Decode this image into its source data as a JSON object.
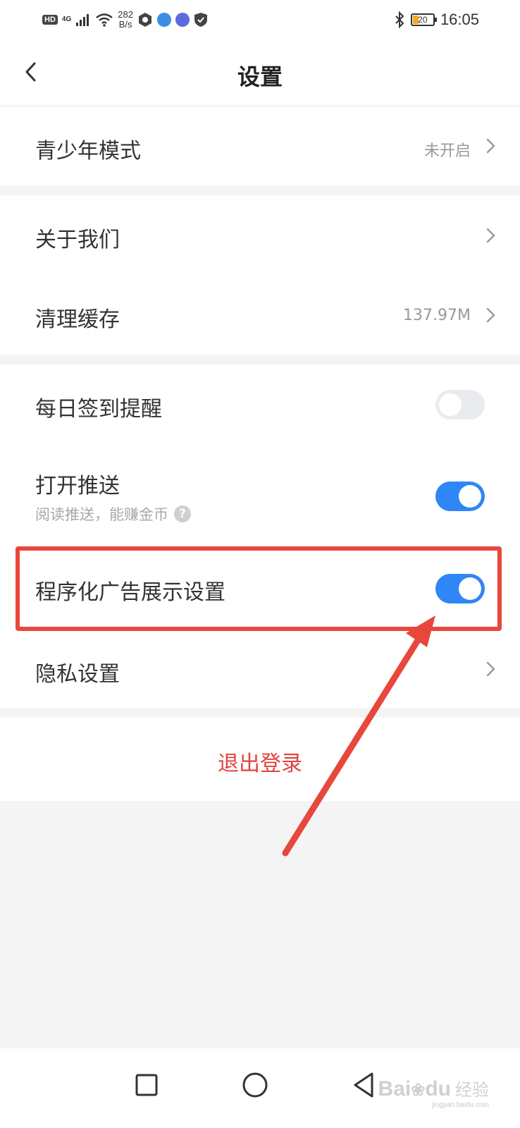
{
  "status_bar": {
    "hd": "HD",
    "network": "4G",
    "speed_value": "282",
    "speed_unit": "B/s",
    "battery_level": "20",
    "time": "16:05"
  },
  "header": {
    "title": "设置",
    "back_icon": "chevron-left-icon"
  },
  "sections": {
    "teen": {
      "label": "青少年模式",
      "value": "未开启"
    },
    "about": {
      "label": "关于我们"
    },
    "cache": {
      "label": "清理缓存",
      "value": "137.97M"
    },
    "checkin": {
      "label": "每日签到提醒",
      "toggle": "off"
    },
    "push": {
      "label": "打开推送",
      "subtitle": "阅读推送，能赚金币",
      "help_glyph": "?",
      "toggle": "on"
    },
    "ads": {
      "label": "程序化广告展示设置",
      "toggle": "on"
    },
    "privacy": {
      "label": "隐私设置"
    }
  },
  "logout": {
    "label": "退出登录"
  },
  "watermark": {
    "brand": "Bai",
    "brand2": "du",
    "cn": "经验",
    "url": "jingyan.baidu.com"
  },
  "colors": {
    "accent_blue": "#2f86f6",
    "danger_red": "#e2423c",
    "annotation_red": "#e8473c",
    "background_gray": "#f4f4f4"
  }
}
